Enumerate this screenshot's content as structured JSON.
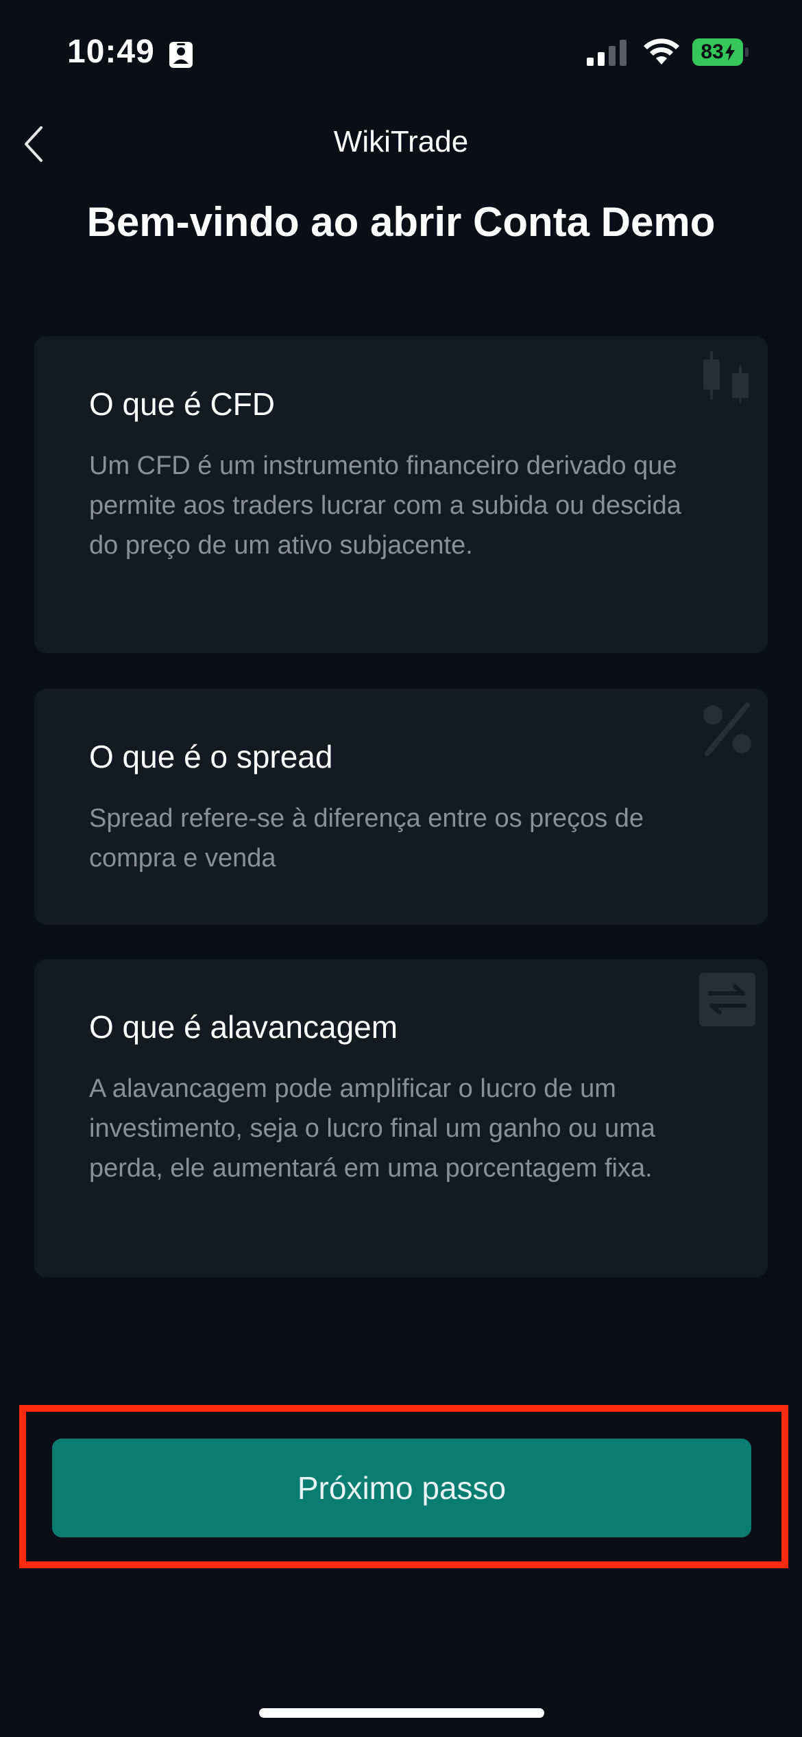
{
  "status_bar": {
    "time": "10:49",
    "battery": "83",
    "battery_color": "#35c759"
  },
  "nav": {
    "title": "WikiTrade",
    "back_icon": "chevron-left-icon"
  },
  "heading": "Bem-vindo ao abrir Conta Demo",
  "cards": [
    {
      "title": "O que é CFD",
      "text": "Um CFD é um instrumento financeiro derivado que permite aos traders lucrar com a subida ou descida do preço de um ativo subjacente.",
      "icon": "candlestick-icon"
    },
    {
      "title": "O que é o spread",
      "text": "Spread refere-se à diferença entre os preços de compra e venda",
      "icon": "percent-icon"
    },
    {
      "title": "O que é alavancagem",
      "text": "A alavancagem pode amplificar o lucro de um investimento, seja o lucro final um ganho ou uma perda, ele aumentará em uma porcentagem fixa.",
      "icon": "swap-arrows-icon"
    }
  ],
  "next_button": {
    "label": "Próximo passo",
    "color": "#0a7d72"
  },
  "highlight_color": "#ff2a10"
}
